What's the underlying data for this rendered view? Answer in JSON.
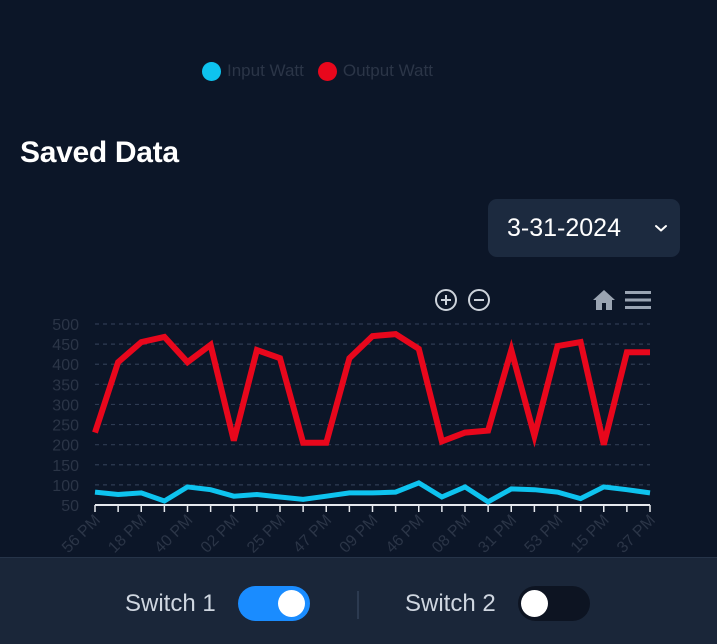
{
  "legend": {
    "items": [
      {
        "label": "Input Watt",
        "color": "#0ec3ef"
      },
      {
        "label": "Output Watt",
        "color": "#e8071c"
      }
    ]
  },
  "section": {
    "title": "Saved Data"
  },
  "date_select": {
    "value": "3-31-2024",
    "icon": "chevron-down-icon"
  },
  "toolbar": {
    "icons": [
      "zoom-in-icon",
      "zoom-out-icon",
      "home-icon",
      "menu-icon"
    ]
  },
  "chart_data": {
    "type": "line",
    "y_ticks": [
      "500",
      "450",
      "400",
      "350",
      "300",
      "250",
      "200",
      "150",
      "100",
      "50"
    ],
    "ylim": [
      50,
      500
    ],
    "x_labels": [
      "56 PM",
      "18 PM",
      "40 PM",
      "02 PM",
      "25 PM",
      "47 PM",
      "09 PM",
      "46 PM",
      "08 PM",
      "31 PM",
      "53 PM",
      "15 PM",
      "37 PM"
    ],
    "grid": true,
    "legend_position": "top",
    "series": [
      {
        "name": "Input Watt",
        "color": "#0ec3ef",
        "values": [
          82,
          76,
          80,
          60,
          95,
          88,
          72,
          76,
          70,
          64,
          72,
          80,
          80,
          82,
          105,
          70,
          95,
          58,
          90,
          88,
          82,
          66,
          95,
          88,
          80
        ]
      },
      {
        "name": "Output Watt",
        "color": "#e8071c",
        "values": [
          230,
          405,
          455,
          468,
          405,
          448,
          210,
          435,
          415,
          205,
          205,
          415,
          470,
          475,
          438,
          208,
          230,
          235,
          435,
          222,
          445,
          455,
          200,
          430,
          430
        ]
      }
    ]
  },
  "switches": [
    {
      "label": "Switch 1",
      "on": true,
      "color": "#1a8cff"
    },
    {
      "label": "Switch 2",
      "on": false,
      "color": "#0d1422"
    }
  ]
}
